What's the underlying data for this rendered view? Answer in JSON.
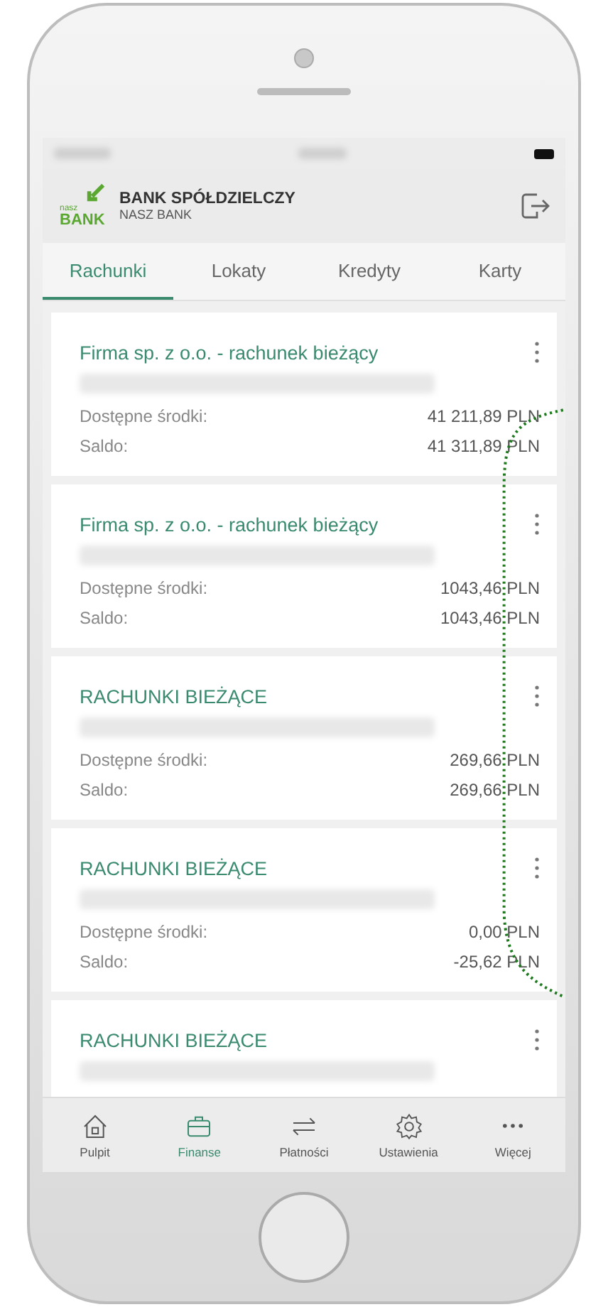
{
  "header": {
    "bank_name": "BANK SPÓŁDZIELCZY",
    "bank_subname": "NASZ BANK",
    "logo_small": "nasz",
    "logo_big": "BANK"
  },
  "tabs": [
    {
      "label": "Rachunki",
      "selected": true
    },
    {
      "label": "Lokaty",
      "selected": false
    },
    {
      "label": "Kredyty",
      "selected": false
    },
    {
      "label": "Karty",
      "selected": false
    }
  ],
  "accounts": [
    {
      "name": "Firma sp. z o.o. - rachunek bieżący",
      "rows": [
        {
          "label": "Dostępne środki:",
          "value": "41 211,89 PLN"
        },
        {
          "label": "Saldo:",
          "value": "41 311,89 PLN"
        }
      ]
    },
    {
      "name": "Firma sp. z o.o. - rachunek bieżący",
      "rows": [
        {
          "label": "Dostępne środki:",
          "value": "1043,46 PLN"
        },
        {
          "label": "Saldo:",
          "value": "1043,46 PLN"
        }
      ]
    },
    {
      "name": "RACHUNKI BIEŻĄCE",
      "rows": [
        {
          "label": "Dostępne środki:",
          "value": "269,66 PLN"
        },
        {
          "label": "Saldo:",
          "value": "269,66 PLN"
        }
      ]
    },
    {
      "name": "RACHUNKI BIEŻĄCE",
      "rows": [
        {
          "label": "Dostępne środki:",
          "value": "0,00 PLN"
        },
        {
          "label": "Saldo:",
          "value": "-25,62 PLN"
        }
      ]
    },
    {
      "name": "RACHUNKI BIEŻĄCE"
    }
  ],
  "bottom_nav": [
    {
      "label": "Pulpit",
      "kind": "home",
      "selected": false
    },
    {
      "label": "Finanse",
      "kind": "finance",
      "selected": true
    },
    {
      "label": "Płatności",
      "kind": "payments",
      "selected": false
    },
    {
      "label": "Ustawienia",
      "kind": "settings",
      "selected": false
    },
    {
      "label": "Więcej",
      "kind": "more",
      "selected": false
    }
  ]
}
